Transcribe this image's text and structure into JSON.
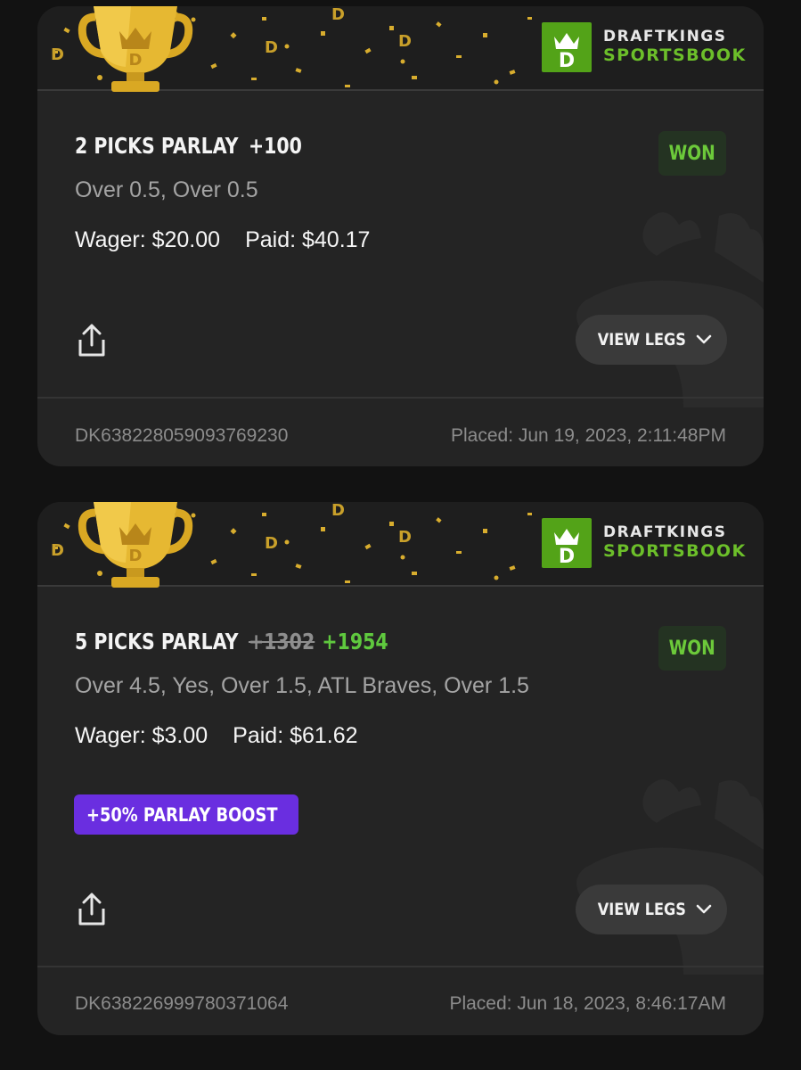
{
  "brand": {
    "line1": "DRAFTKINGS",
    "line2": "SPORTSBOOK",
    "colors": {
      "green": "#53a318",
      "gold": "#e6b832",
      "background": "#242424"
    }
  },
  "bets": [
    {
      "title": "2 PICKS PARLAY",
      "odds": "+100",
      "status": "WON",
      "selections": "Over 0.5, Over 0.5",
      "wager": "Wager: $20.00",
      "paid": "Paid: $40.17",
      "view_legs_label": "VIEW LEGS",
      "bet_id": "DK638228059093769230",
      "placed": "Placed: Jun 19, 2023, 2:11:48PM"
    },
    {
      "title": "5 PICKS PARLAY",
      "original_odds": "+1302",
      "boosted_odds": "+1954",
      "status": "WON",
      "selections": "Over 4.5, Yes, Over 1.5, ATL Braves, Over 1.5",
      "wager": "Wager: $3.00",
      "paid": "Paid: $61.62",
      "boost_badge": "+50% PARLAY BOOST",
      "view_legs_label": "VIEW LEGS",
      "bet_id": "DK638226999780371064",
      "placed": "Placed: Jun 18, 2023, 8:46:17AM"
    }
  ],
  "icons": [
    "trophy-icon",
    "draftkings-logo-icon",
    "share-icon",
    "chevron-down-icon"
  ]
}
